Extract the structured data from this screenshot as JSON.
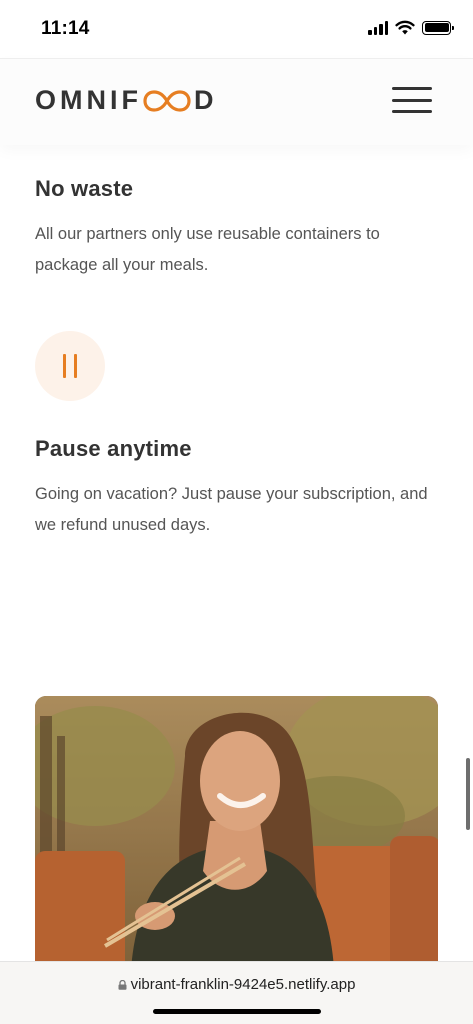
{
  "status_bar": {
    "time": "11:14"
  },
  "header": {
    "logo_left": "OMNIF",
    "logo_right": "D",
    "logo_accent_color": "#e67e22",
    "menu_icon": "hamburger-menu-icon"
  },
  "features": [
    {
      "title": "No waste",
      "text": "All our partners only use reusable containers to package all your meals."
    },
    {
      "icon": "pause-icon",
      "title": "Pause anytime",
      "text": "Going on vacation? Just pause your subscription, and we refund unused days."
    }
  ],
  "colors": {
    "accent": "#e67e22",
    "accent_tint": "#fdf2e9",
    "text_dark": "#333333",
    "text_body": "#555555"
  },
  "browser": {
    "url": "vibrant-franklin-9424e5.netlify.app",
    "lock_icon": "lock-icon"
  }
}
